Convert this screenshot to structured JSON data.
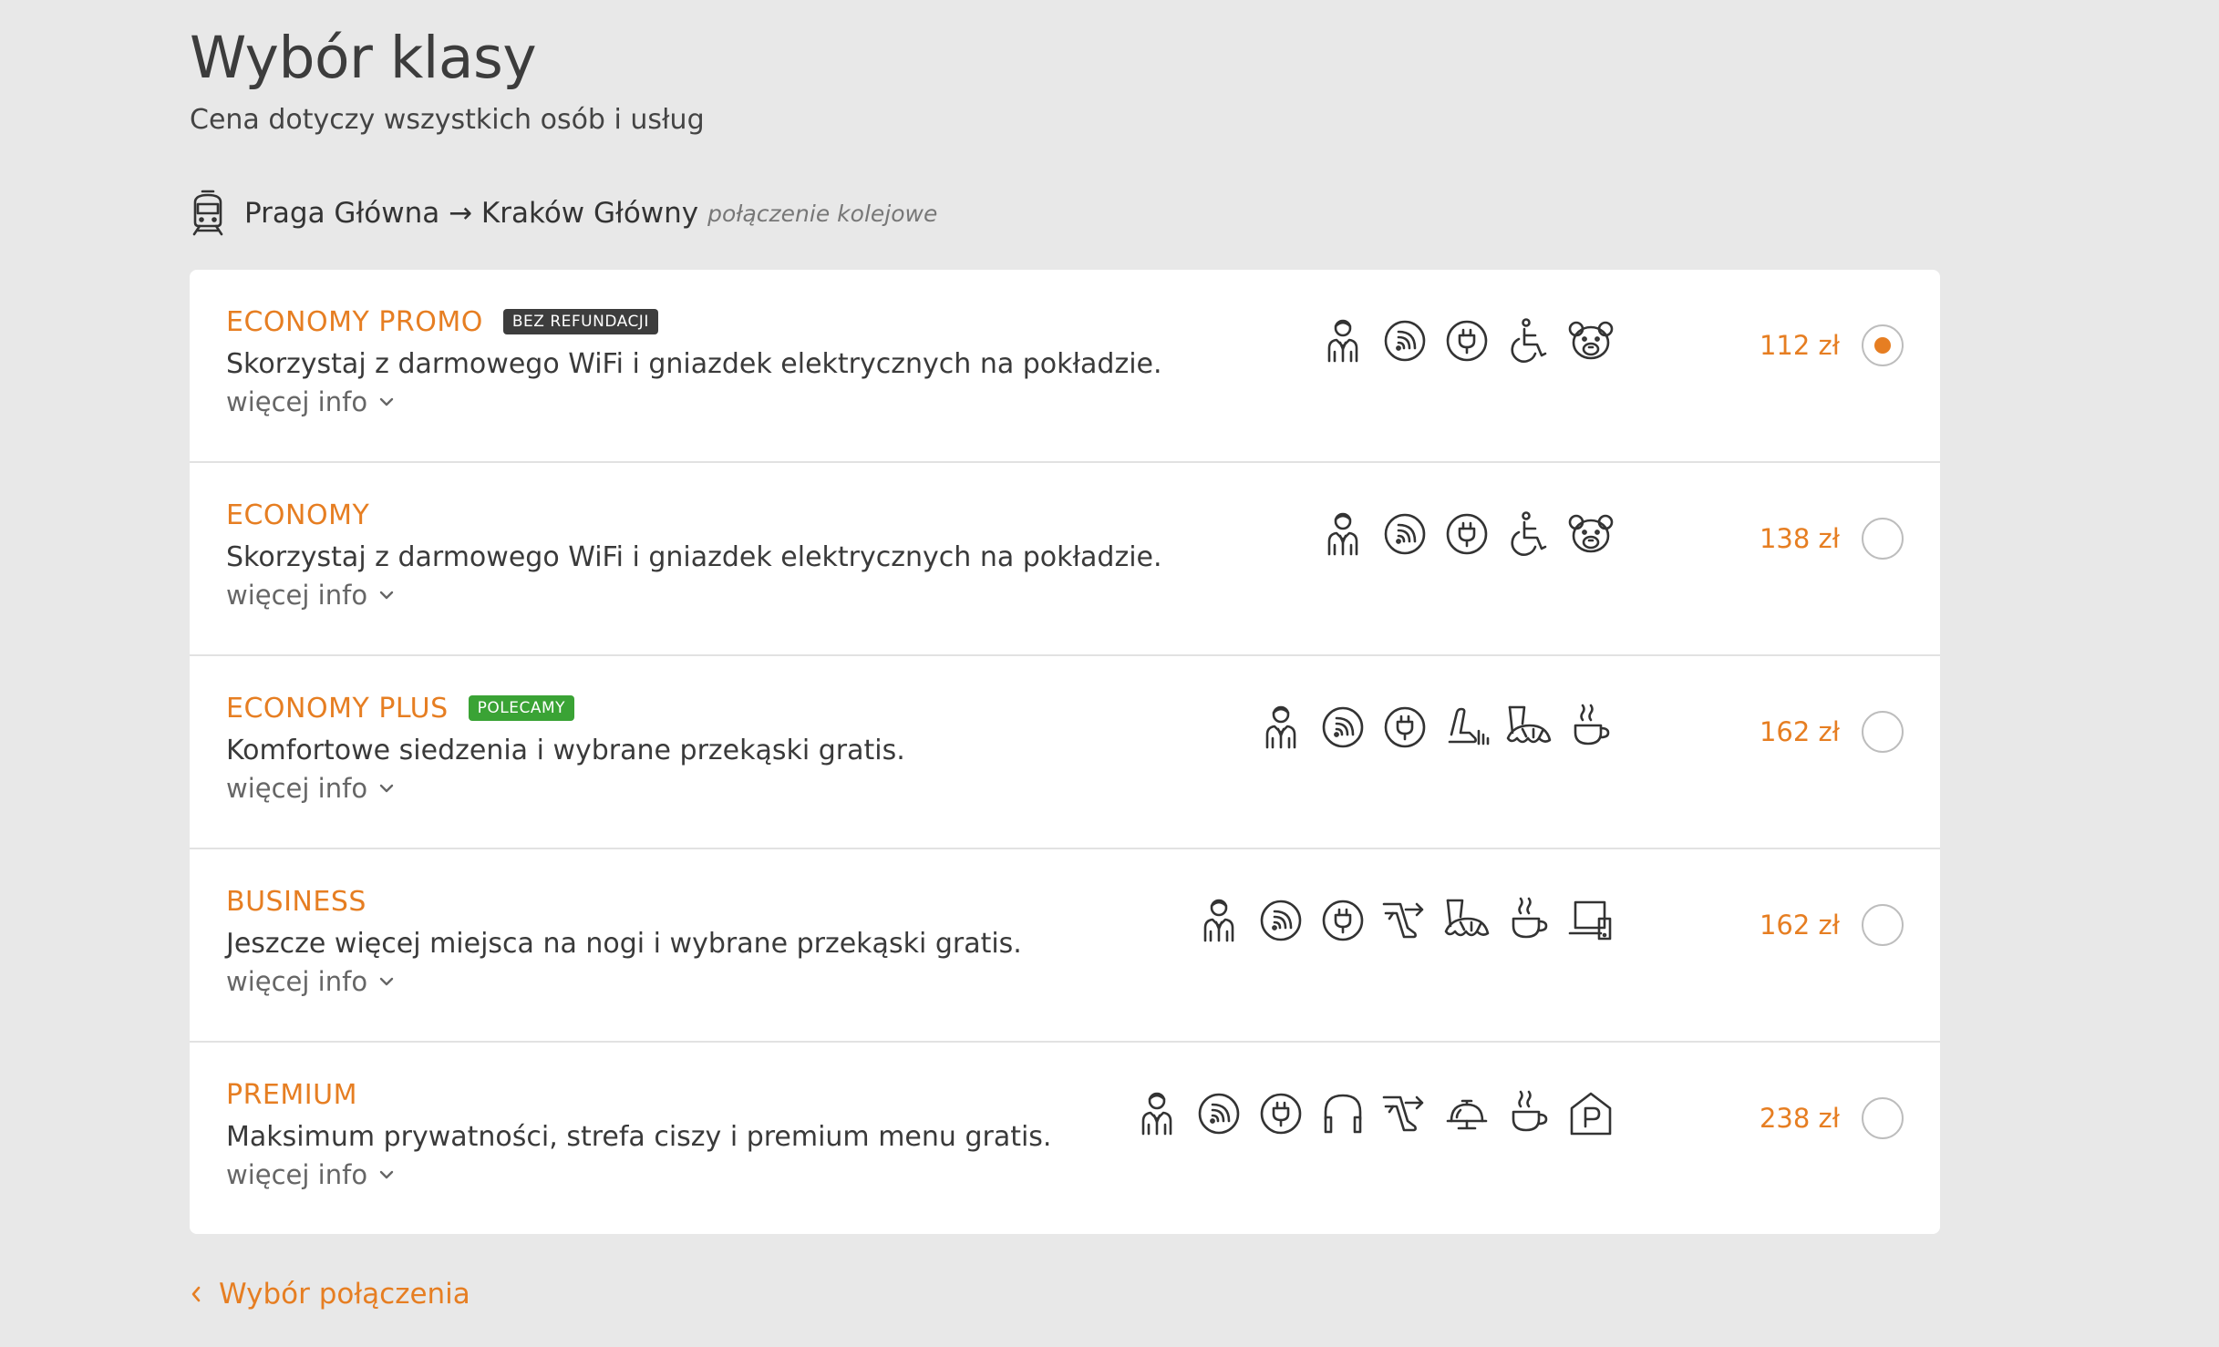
{
  "page": {
    "title": "Wybór klasy",
    "subtitle": "Cena dotyczy wszystkich osób i usług"
  },
  "route": {
    "text": "Praga Główna → Kraków Główny",
    "type": "połączenie kolejowe",
    "icon": "train-icon"
  },
  "more_info_label": "więcej info",
  "classes": [
    {
      "name": "ECONOMY PROMO",
      "badge": "BEZ REFUNDACJI",
      "description": "Skorzystaj z darmowego WiFi i gniazdek elektrycznych na pokładzie.",
      "price": "112 zł",
      "selected": true,
      "icons": [
        "steward-icon",
        "wifi-icon",
        "power-socket-icon",
        "wheelchair-icon",
        "teddy-bear-icon"
      ]
    },
    {
      "name": "ECONOMY",
      "badge": "",
      "description": "Skorzystaj z darmowego WiFi i gniazdek elektrycznych na pokładzie.",
      "price": "138 zł",
      "selected": false,
      "icons": [
        "steward-icon",
        "wifi-icon",
        "power-socket-icon",
        "wheelchair-icon",
        "teddy-bear-icon"
      ]
    },
    {
      "name": "ECONOMY PLUS",
      "badge": "POLECAMY",
      "description": "Komfortowe siedzenia i wybrane przekąski gratis.",
      "price": "162 zł",
      "selected": false,
      "icons": [
        "steward-icon",
        "wifi-icon",
        "power-socket-icon",
        "comfort-seat-icon",
        "snack-icon",
        "hot-drink-icon"
      ]
    },
    {
      "name": "BUSINESS",
      "badge": "",
      "description": "Jeszcze więcej miejsca na nogi i wybrane przekąski gratis.",
      "price": "162 zł",
      "selected": false,
      "icons": [
        "steward-icon",
        "wifi-icon",
        "power-socket-icon",
        "legroom-icon",
        "snack-icon",
        "hot-drink-icon",
        "workspace-icon"
      ]
    },
    {
      "name": "PREMIUM",
      "badge": "",
      "description": "Maksimum prywatności, strefa ciszy i premium menu gratis.",
      "price": "238 zł",
      "selected": false,
      "icons": [
        "steward-icon",
        "wifi-icon",
        "power-socket-icon",
        "headphones-icon",
        "legroom-icon",
        "premium-meal-icon",
        "hot-drink-icon",
        "parking-icon"
      ]
    }
  ],
  "back_link": "Wybór połączenia",
  "colors": {
    "accent": "#e67e22",
    "badge_dark": "#3d3d3d",
    "badge_green": "#3aa335",
    "background": "#e8e8e8"
  }
}
